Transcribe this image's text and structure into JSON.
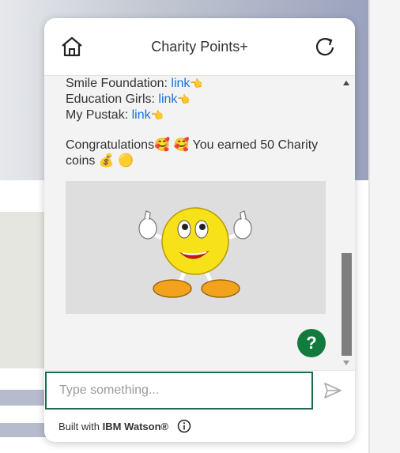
{
  "header": {
    "title": "Charity Points+",
    "home_icon": "home-icon",
    "refresh_icon": "refresh-icon"
  },
  "messages": {
    "links": [
      {
        "label": "Smile Foundation: ",
        "link_text": "link",
        "emoji": "👈"
      },
      {
        "label": "Education Girls: ",
        "link_text": "link",
        "emoji": "👈"
      },
      {
        "label": "My Pustak: ",
        "link_text": "link",
        "emoji": "👈"
      }
    ],
    "congrats_line1": "Congratulations🥰 🥰 You earned 50 Charity",
    "congrats_line2": "coins 💰 🟡",
    "image_alt": "smiley thumbs up"
  },
  "help_button": {
    "label": "?"
  },
  "input": {
    "placeholder": "Type something...",
    "value": ""
  },
  "footer": {
    "prefix": "Built with ",
    "brand": "IBM Watson®"
  },
  "colors": {
    "accent_green": "#117a3d",
    "link_blue": "#1a6fd6",
    "input_border": "#1f6a47"
  }
}
